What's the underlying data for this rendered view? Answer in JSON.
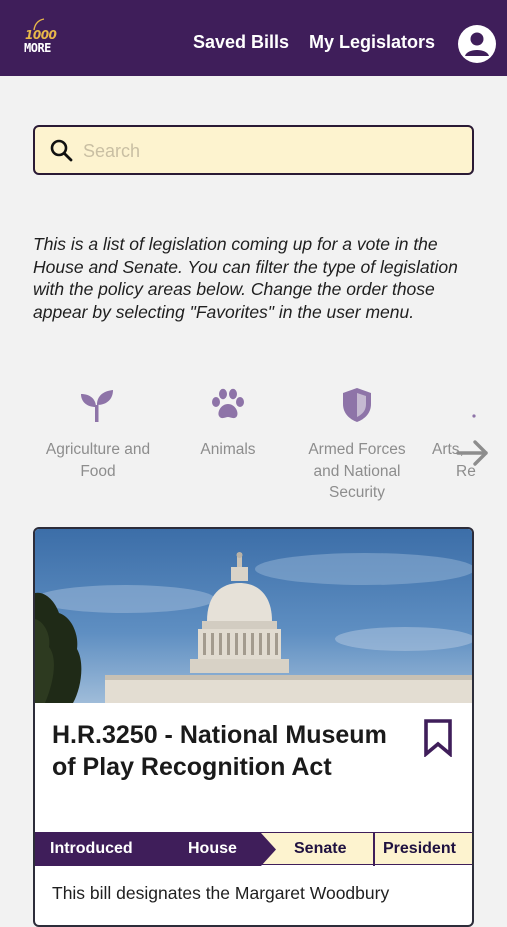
{
  "header": {
    "logo_number": "1000",
    "logo_word": "MORE",
    "saved_bills": "Saved Bills",
    "my_legislators": "My Legislators",
    "avatar_icon": "user-icon"
  },
  "colors": {
    "brand_purple": "#3f1e5a",
    "search_bg": "#fdf3cf",
    "category_icon": "#8e74a8",
    "logo_gold": "#e8b84a"
  },
  "search": {
    "placeholder": "Search",
    "value": ""
  },
  "intro_text": "This is a list of legislation coming up for a vote in the House and Senate. You can filter the type of legislation with the policy areas below. Change the order those appear by selecting \"Favorites\" in the user menu.",
  "categories": [
    {
      "icon": "sprout-icon",
      "line1": "Agriculture and",
      "line2": "Food",
      "line3": ""
    },
    {
      "icon": "paw-icon",
      "line1": "Animals",
      "line2": "",
      "line3": ""
    },
    {
      "icon": "shield-icon",
      "line1": "Armed Forces",
      "line2": "and National",
      "line3": "Security"
    },
    {
      "icon": "palette-icon",
      "line1": "Arts,",
      "line2": "Re",
      "line3": ""
    }
  ],
  "bill": {
    "image": "us-capitol-dome-photo",
    "title": "H.R.3250 - National Museum of Play Recognition Act",
    "bookmark_icon": "bookmark-icon",
    "stages": [
      "Introduced",
      "House",
      "Senate",
      "President"
    ],
    "current_stage": "House",
    "summary_start": "This bill designates the Margaret Woodbury"
  }
}
